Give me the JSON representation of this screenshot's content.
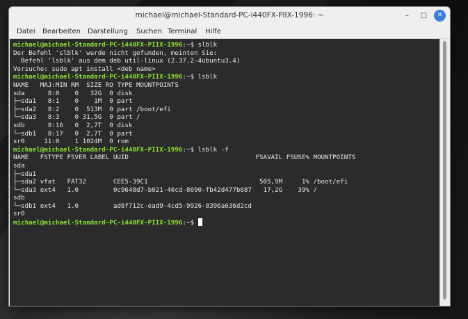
{
  "window": {
    "title": "michael@michael-Standard-PC-i440FX-PIIX-1996: ~",
    "minimize_glyph": "–",
    "maximize_glyph": "□",
    "close_glyph": "✕"
  },
  "menu": [
    {
      "label": "Datei"
    },
    {
      "label": "Bearbeiten"
    },
    {
      "label": "Darstellung"
    },
    {
      "label": "Suchen"
    },
    {
      "label": "Terminal"
    },
    {
      "label": "Hilfe"
    }
  ],
  "terminal": {
    "prompt": "michael@michael-Standard-PC-i440FX-PIIX-1996",
    "lines": [
      {
        "type": "cmd",
        "cmd": "slblk"
      },
      {
        "text": "Der Befehl 'slblk' wurde nicht gefunden, meinten Sie:"
      },
      {
        "text": "  Befehl 'lsblk' aus dem deb util-linux (2.37.2-4ubuntu3.4)"
      },
      {
        "text": "Versuche: sudo apt install <deb name>"
      },
      {
        "type": "cmd",
        "cmd": "lsblk"
      },
      {
        "text": "NAME   MAJ:MIN RM  SIZE RO TYPE MOUNTPOINTS"
      },
      {
        "text": "sda      8:0    0   32G  0 disk"
      },
      {
        "text": "├─sda1   8:1    0    1M  0 part"
      },
      {
        "text": "├─sda2   8:2    0  513M  0 part /boot/efi"
      },
      {
        "text": "└─sda3   8:3    0 31,5G  0 part /"
      },
      {
        "text": "sdb      8:16   0  2,7T  0 disk"
      },
      {
        "text": "└─sdb1   8:17   0  2,7T  0 part"
      },
      {
        "text": "sr0     11:0    1 1024M  0 rom"
      },
      {
        "type": "cmd",
        "cmd": "lsblk -f"
      },
      {
        "text": "NAME   FSTYPE FSVER LABEL UUID                                 FSAVAIL FSUSE% MOUNTPOINTS"
      },
      {
        "text": "sda"
      },
      {
        "text": "├─sda1"
      },
      {
        "text": "├─sda2 vfat   FAT32       CEE5-39C1                             505,9M     1% /boot/efi"
      },
      {
        "text": "└─sda3 ext4   1.0         0c9648d7-b021-40cd-8690-fb42d477b687   17,2G    39% /"
      },
      {
        "text": "sdb"
      },
      {
        "text": "└─sdb1 ext4   1.0         ad6f712c-ead9-4cd5-9926-8396a636d2cd"
      },
      {
        "text": "sr0"
      },
      {
        "type": "cmd",
        "cmd": "",
        "cursor": true
      }
    ]
  },
  "colors": {
    "prompt": "#8ae234",
    "terminal_bg": "#2b2b2b",
    "terminal_fg": "#e8e8e8",
    "close_button": "#3b7dd8"
  }
}
